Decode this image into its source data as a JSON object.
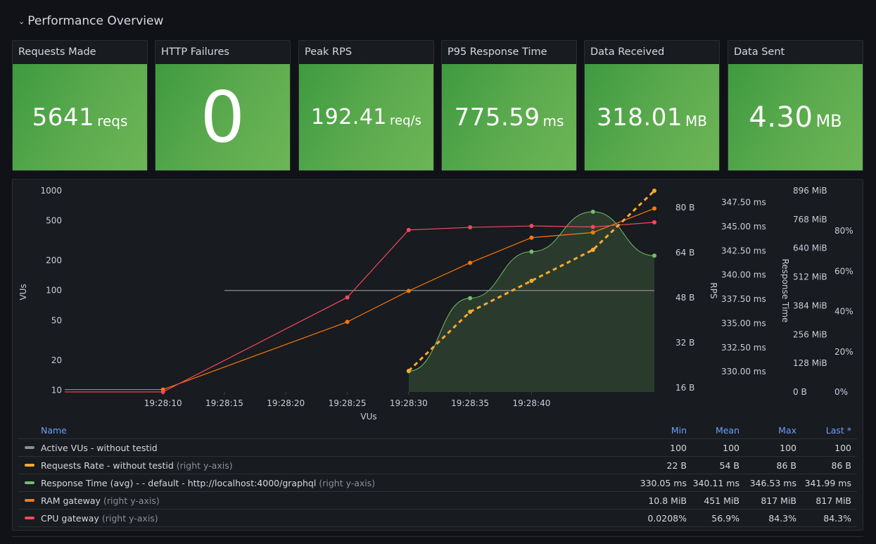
{
  "row": {
    "title": "Performance Overview",
    "chevron_icon": "⌄"
  },
  "stats": [
    {
      "title": "Requests Made",
      "value": "5641",
      "unit": "reqs"
    },
    {
      "title": "HTTP Failures",
      "value": "0",
      "unit": ""
    },
    {
      "title": "Peak RPS",
      "value": "192.41",
      "unit": "req/s"
    },
    {
      "title": "P95 Response Time",
      "value": "775.59",
      "unit": "ms"
    },
    {
      "title": "Data Received",
      "value": "318.01",
      "unit": "MB"
    },
    {
      "title": "Data Sent",
      "value": "4.30",
      "unit": "MB"
    }
  ],
  "colors": {
    "stat_green": "#56a64b",
    "active_vus": "#8e8e8e",
    "requests_rate": "#ffa930",
    "response_time": "#73bf69",
    "ram": "#ff780a",
    "cpu": "#f2495c",
    "legend_header": "#6e9fff"
  },
  "chart_data": {
    "type": "line",
    "title": "",
    "xlabel": "VUs",
    "x": [
      "19:28:10",
      "19:28:15",
      "19:28:20",
      "19:28:25",
      "19:28:30",
      "19:28:35",
      "19:28:40"
    ],
    "x_start_offset_seconds": -8,
    "grid": false,
    "legend_placement": "bottom",
    "axes": {
      "left": {
        "label": "VUs",
        "scale": "log",
        "range": [
          9.6,
          1000
        ],
        "ticks": [
          "1000",
          "500",
          "200",
          "100",
          "50",
          "20",
          "10"
        ]
      },
      "rps": {
        "label": "RPS",
        "range": [
          14.5,
          86
        ],
        "ticks": [
          "80 B",
          "64 B",
          "48 B",
          "32 B",
          "16 B"
        ]
      },
      "response_time": {
        "label": "Response Time",
        "range": [
          327.9,
          348.7
        ],
        "ticks": [
          "347.50 ms",
          "345.00 ms",
          "342.50 ms",
          "340.00 ms",
          "337.50 ms",
          "335.00 ms",
          "332.50 ms",
          "330.00 ms"
        ]
      },
      "ram": {
        "label": "",
        "range": [
          0,
          896
        ],
        "ticks": [
          "896 MiB",
          "768 MiB",
          "640 MiB",
          "512 MiB",
          "384 MiB",
          "256 MiB",
          "128 MiB",
          "0 B"
        ]
      },
      "cpu": {
        "label": "",
        "range": [
          0,
          100
        ],
        "ticks": [
          "80%",
          "60%",
          "40%",
          "20%",
          "0%"
        ]
      }
    },
    "series": [
      {
        "name": "Active VUs - without testid",
        "axis": "left",
        "x_seconds": [
          5,
          40
        ],
        "values": [
          100,
          100
        ],
        "style": "line"
      },
      {
        "name": "Requests Rate - without testid",
        "axis": "rps",
        "x_seconds": [
          20,
          25,
          30,
          35,
          40
        ],
        "values": [
          22,
          43,
          54,
          65,
          86
        ],
        "style": "dashed"
      },
      {
        "name": "Response Time (avg) - - default - http://localhost:4000/graphql",
        "axis": "response_time",
        "x_seconds": [
          20,
          25,
          30,
          35,
          40
        ],
        "values": [
          330.05,
          337.6,
          342.4,
          346.53,
          341.99
        ],
        "style": "smooth-area"
      },
      {
        "name": "RAM gateway",
        "axis": "ram",
        "x_seconds": [
          -8,
          0,
          5,
          10,
          15,
          20,
          25,
          30,
          35,
          40
        ],
        "values": [
          10.8,
          10.8,
          312,
          450,
          575,
          687,
          710,
          817
        ],
        "style": "line"
      },
      {
        "name": "CPU gateway",
        "axis": "cpu",
        "x_seconds": [
          -8,
          0,
          5,
          10,
          15,
          20,
          25,
          30,
          35,
          40
        ],
        "values": [
          0.0208,
          0.0208,
          47,
          80.5,
          81.8,
          82.5,
          82,
          84.3
        ],
        "style": "line"
      }
    ]
  },
  "legend": {
    "headers": {
      "name": "Name",
      "min": "Min",
      "mean": "Mean",
      "max": "Max",
      "last": "Last *"
    },
    "rows": [
      {
        "name": "Active VUs - without testid",
        "axis_note": "",
        "min": "100",
        "mean": "100",
        "max": "100",
        "last": "100"
      },
      {
        "name": "Requests Rate - without testid",
        "axis_note": "(right y-axis)",
        "min": "22 B",
        "mean": "54 B",
        "max": "86 B",
        "last": "86 B"
      },
      {
        "name": "Response Time (avg) - - default - http://localhost:4000/graphql",
        "axis_note": "(right y-axis)",
        "min": "330.05 ms",
        "mean": "340.11 ms",
        "max": "346.53 ms",
        "last": "341.99 ms"
      },
      {
        "name": "RAM gateway",
        "axis_note": "(right y-axis)",
        "min": "10.8 MiB",
        "mean": "451 MiB",
        "max": "817 MiB",
        "last": "817 MiB"
      },
      {
        "name": "CPU gateway",
        "axis_note": "(right y-axis)",
        "min": "0.0208%",
        "mean": "56.9%",
        "max": "84.3%",
        "last": "84.3%"
      }
    ]
  }
}
